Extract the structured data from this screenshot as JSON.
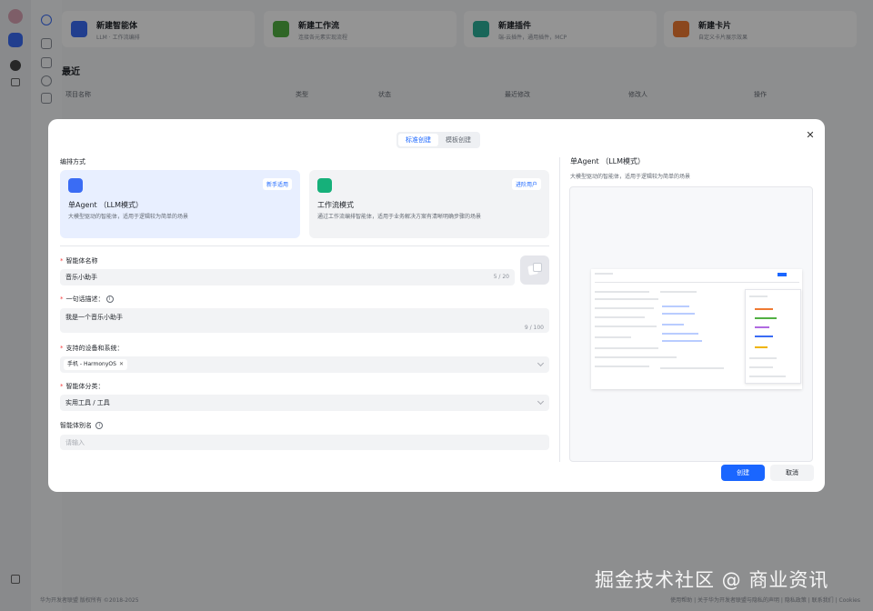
{
  "background": {
    "create_cards": [
      {
        "title": "新建智能体",
        "subtitle": "LLM · 工作流编排",
        "color": "#3a6cf4"
      },
      {
        "title": "新建工作流",
        "subtitle": "连接各元素实现流程",
        "color": "#52b043"
      },
      {
        "title": "新建插件",
        "subtitle": "端-云插件，通用插件，MCP",
        "color": "#2bb09a"
      },
      {
        "title": "新建卡片",
        "subtitle": "自定义卡片展示效果",
        "color": "#ef7a33"
      }
    ],
    "recent_title": "最近",
    "table_headers": [
      "项目名称",
      "类型",
      "状态",
      "最近修改",
      "修改人",
      "操作"
    ],
    "footer_left": "华为开发者联盟 版权所有 ©2018-2025",
    "footer_right": "使用帮助 | 关于华为开发者联盟与隐私的声明 | 隐私政策 | 联系我们 | Cookies"
  },
  "dialog": {
    "tabs": [
      "标准创建",
      "模板创建"
    ],
    "active_tab": 0,
    "mode_section_label": "编排方式",
    "modes": [
      {
        "title": "单Agent （LLM模式）",
        "desc": "大模型驱动的智能体，适用于逻辑较为简单的场景",
        "tag": "新手适用",
        "selected": true,
        "icon": "robot-icon"
      },
      {
        "title": "工作流模式",
        "desc": "通过工作流编排智能体，适用于业务解决方案有清晰明确步骤的场景",
        "tag": "进阶用户",
        "selected": false,
        "icon": "workflow-icon"
      }
    ],
    "name": {
      "label": "智能体名称",
      "value": "音乐小助手",
      "count": "5 / 20"
    },
    "intro": {
      "label": "一句话描述",
      "value": "我是一个音乐小助手",
      "count": "9 / 100"
    },
    "devices": {
      "label": "支持的设备和系统",
      "chip": "手机 - HarmonyOS"
    },
    "category": {
      "label": "智能体分类",
      "value": "实用工具 / 工具"
    },
    "alias": {
      "label": "智能体别名",
      "placeholder": "请输入"
    },
    "preview": {
      "title": "单Agent （LLM模式）",
      "desc": "大模型驱动的智能体，适用于逻辑较为简单的场景"
    },
    "confirm_label": "创建",
    "cancel_label": "取消"
  },
  "watermark": "掘金技术社区 @ 商业资讯"
}
